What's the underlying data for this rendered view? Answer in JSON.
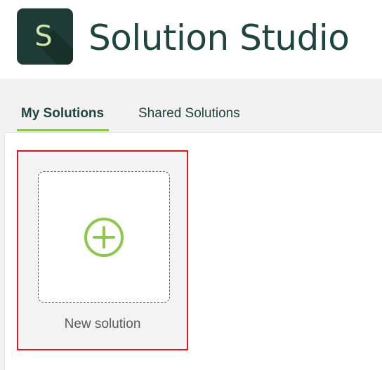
{
  "app": {
    "logo_letter": "S",
    "title": "Solution Studio"
  },
  "tabs": [
    {
      "label": "My Solutions",
      "active": true
    },
    {
      "label": "Shared Solutions",
      "active": false
    }
  ],
  "new_card": {
    "label": "New solution",
    "icon": "plus-circle-icon"
  },
  "colors": {
    "brand_dark": "#1f3b36",
    "title_text": "#1f4541",
    "accent_green": "#8dc84a",
    "selection_red": "#d9191c"
  }
}
